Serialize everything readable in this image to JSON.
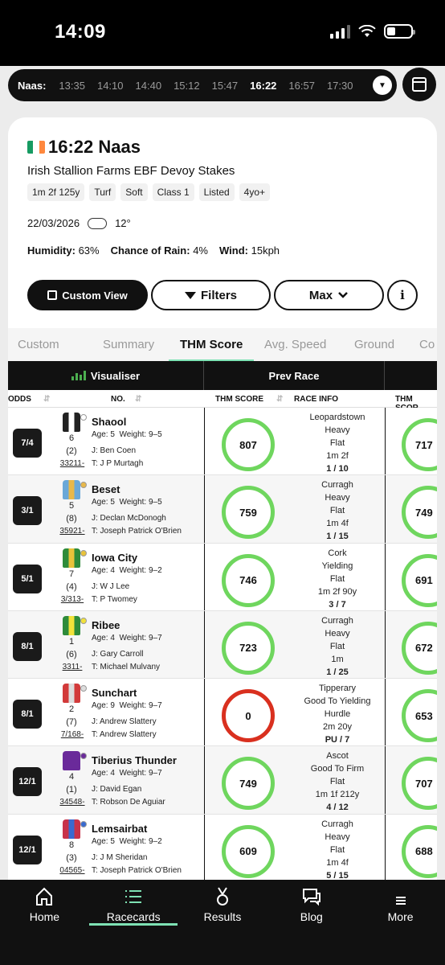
{
  "status": {
    "time": "14:09"
  },
  "time_nav": {
    "venue": "Naas:",
    "times": [
      "13:35",
      "14:10",
      "14:40",
      "15:12",
      "15:47",
      "16:22",
      "16:57",
      "17:30"
    ],
    "active_time": "16:22"
  },
  "race": {
    "title": "16:22 Naas",
    "name": "Irish Stallion Farms EBF Devoy Stakes",
    "tags": [
      "1m 2f 125y",
      "Turf",
      "Soft",
      "Class 1",
      "Listed",
      "4yo+"
    ],
    "date": "22/03/2026",
    "temperature": "12°",
    "humidity_label": "Humidity:",
    "humidity": "63%",
    "rain_label": "Chance of Rain:",
    "rain": "4%",
    "wind_label": "Wind:",
    "wind": "15kph"
  },
  "buttons": {
    "custom_view": "Custom View",
    "filters": "Filters",
    "max": "Max",
    "info": "i"
  },
  "tabs": [
    "Custom",
    "Summary",
    "THM Score",
    "Avg. Speed",
    "Ground",
    "Co"
  ],
  "active_tab": "THM Score",
  "table": {
    "group_visualiser": "Visualiser",
    "group_prev": "Prev Race",
    "col_odds": "ODDS",
    "col_no": "NO.",
    "col_thm": "THM SCORE",
    "col_race_info": "RACE INFO",
    "col_thm2": "THM SCOR"
  },
  "runners": [
    {
      "odds": "7/4",
      "num": "6",
      "draw": "(2)",
      "form": "33211-",
      "name": "Shaool",
      "age": "Age: 5",
      "weight": "Weight: 9–5",
      "jockey": "J: Ben Coen",
      "trainer": "T: J P Murtagh",
      "score": "807",
      "course": "Leopardstown",
      "going": "Heavy",
      "type": "Flat",
      "dist": "1m 2f",
      "result": "1 / 10",
      "score2": "717",
      "silk_color": "#222222",
      "silk_alt": "#ffffff"
    },
    {
      "odds": "3/1",
      "num": "5",
      "draw": "(8)",
      "form": "35921-",
      "name": "Beset",
      "age": "Age: 5",
      "weight": "Weight: 9–5",
      "jockey": "J: Declan McDonogh",
      "trainer": "T: Joseph Patrick O'Brien",
      "score": "759",
      "course": "Curragh",
      "going": "Heavy",
      "type": "Flat",
      "dist": "1m 4f",
      "result": "1 / 15",
      "score2": "749",
      "silk_color": "#6aa8d8",
      "silk_alt": "#e8b84a"
    },
    {
      "odds": "5/1",
      "num": "7",
      "draw": "(4)",
      "form": "3/313-",
      "name": "Iowa City",
      "age": "Age: 4",
      "weight": "Weight: 9–2",
      "jockey": "J: W J Lee",
      "trainer": "T: P Twomey",
      "score": "746",
      "course": "Cork",
      "going": "Yielding",
      "type": "Flat",
      "dist": "1m 2f 90y",
      "result": "3 / 7",
      "score2": "691",
      "silk_color": "#2e8b3a",
      "silk_alt": "#e8c33a"
    },
    {
      "odds": "8/1",
      "num": "1",
      "draw": "(6)",
      "form": "3311-",
      "name": "Ribee",
      "age": "Age: 4",
      "weight": "Weight: 9–7",
      "jockey": "J: Gary Carroll",
      "trainer": "T: Michael Mulvany",
      "score": "723",
      "course": "Curragh",
      "going": "Heavy",
      "type": "Flat",
      "dist": "1m",
      "result": "1 / 25",
      "score2": "672",
      "silk_color": "#2e8b3a",
      "silk_alt": "#f2e23a"
    },
    {
      "odds": "8/1",
      "num": "2",
      "draw": "(7)",
      "form": "7/168-",
      "name": "Sunchart",
      "age": "Age: 9",
      "weight": "Weight: 9–7",
      "jockey": "J: Andrew Slattery",
      "trainer": "T: Andrew Slattery",
      "score": "0",
      "course": "Tipperary",
      "going": "Good To Yielding",
      "type": "Hurdle",
      "dist": "2m 20y",
      "result": "PU / 7",
      "score2": "653",
      "silk_color": "#d23a3a",
      "silk_alt": "#dddddd"
    },
    {
      "odds": "12/1",
      "num": "4",
      "draw": "(1)",
      "form": "34548-",
      "name": "Tiberius Thunder",
      "age": "Age: 4",
      "weight": "Weight: 9–7",
      "jockey": "J: David Egan",
      "trainer": "T: Robson De Aguiar",
      "score": "749",
      "course": "Ascot",
      "going": "Good To Firm",
      "type": "Flat",
      "dist": "1m 1f 212y",
      "result": "4 / 12",
      "score2": "707",
      "silk_color": "#6a2a9a",
      "silk_alt": "#6a2a9a"
    },
    {
      "odds": "12/1",
      "num": "8",
      "draw": "(3)",
      "form": "04565-",
      "name": "Lemsairbat",
      "age": "Age: 5",
      "weight": "Weight: 9–2",
      "jockey": "J: J M Sheridan",
      "trainer": "T: Joseph Patrick O'Brien",
      "score": "609",
      "course": "Curragh",
      "going": "Heavy",
      "type": "Flat",
      "dist": "1m 4f",
      "result": "5 / 15",
      "score2": "688",
      "silk_color": "#c8324a",
      "silk_alt": "#3a6ad0"
    }
  ],
  "bottom_nav": [
    "Home",
    "Racecards",
    "Results",
    "Blog",
    "More"
  ],
  "colors": {
    "accent": "#7ee2b4",
    "ring_green": "#6fd65e",
    "ring_red": "#d9301f"
  }
}
